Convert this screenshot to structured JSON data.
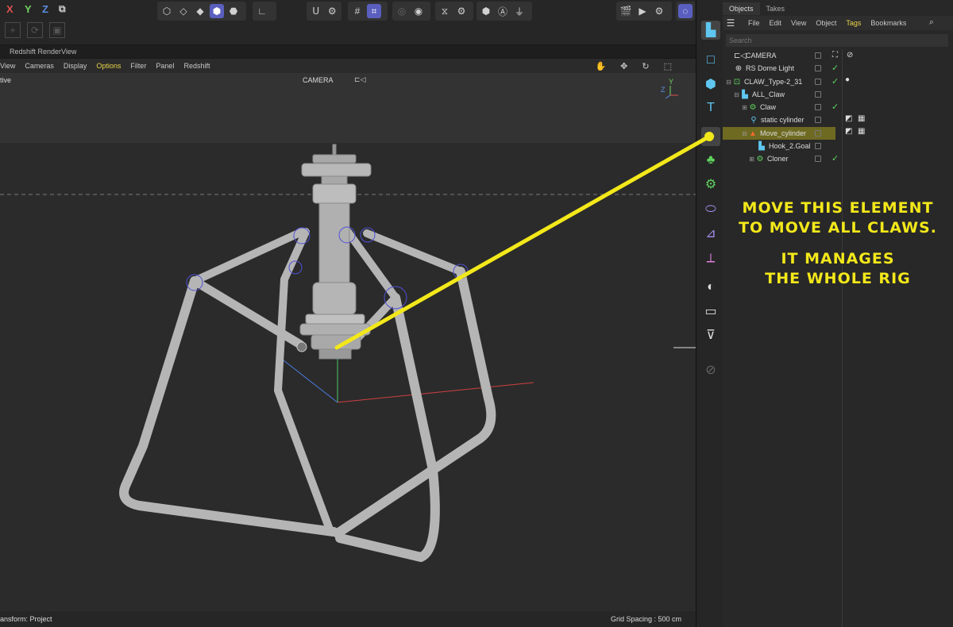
{
  "toolbar": {
    "axis_x": "X",
    "axis_y": "Y",
    "axis_z": "Z",
    "axis_x_color": "#e05050",
    "axis_y_color": "#6fd35f",
    "axis_z_color": "#5a8ee0"
  },
  "viewport": {
    "window_title": "Redshift RenderView",
    "menu": [
      "Cameras",
      "Display",
      "Options",
      "Filter",
      "Panel",
      "Redshift"
    ],
    "menu_partial": "View",
    "highlight_menu": "Options",
    "partial_label": "tive",
    "camera_label": "CAMERA",
    "axis_labels": [
      "Z",
      "Y"
    ],
    "footer_left": "ansform: Project",
    "footer_right": "Grid Spacing : 500 cm"
  },
  "panel": {
    "tabs": [
      "Objects",
      "Takes"
    ],
    "menu": [
      "File",
      "Edit",
      "View",
      "Object",
      "Tags",
      "Bookmarks"
    ],
    "highlight_menu": "Tags",
    "search_placeholder": "Search",
    "tree": [
      {
        "label": "CAMERA",
        "icon": "camera-icon"
      },
      {
        "label": "RS Dome Light",
        "icon": "globe-icon"
      },
      {
        "label": "CLAW_Type-2_31",
        "icon": "null-icon"
      },
      {
        "label": "ALL_Claw",
        "icon": "null-icon"
      },
      {
        "label": "Claw",
        "icon": "gear-icon"
      },
      {
        "label": "static cylinder",
        "icon": "cylinder-icon"
      },
      {
        "label": "Move_cylinder",
        "icon": "cone-icon",
        "selected": true
      },
      {
        "label": "Hook_2.Goal",
        "icon": "null-icon"
      },
      {
        "label": "Cloner",
        "icon": "cloner-icon"
      }
    ]
  },
  "annotation": {
    "line1": "MOVE THIS ELEMENT",
    "line2": "TO MOVE ALL CLAWS.",
    "line3": "IT MANAGES",
    "line4": "THE WHOLE RIG",
    "color": "#f3e81a"
  }
}
